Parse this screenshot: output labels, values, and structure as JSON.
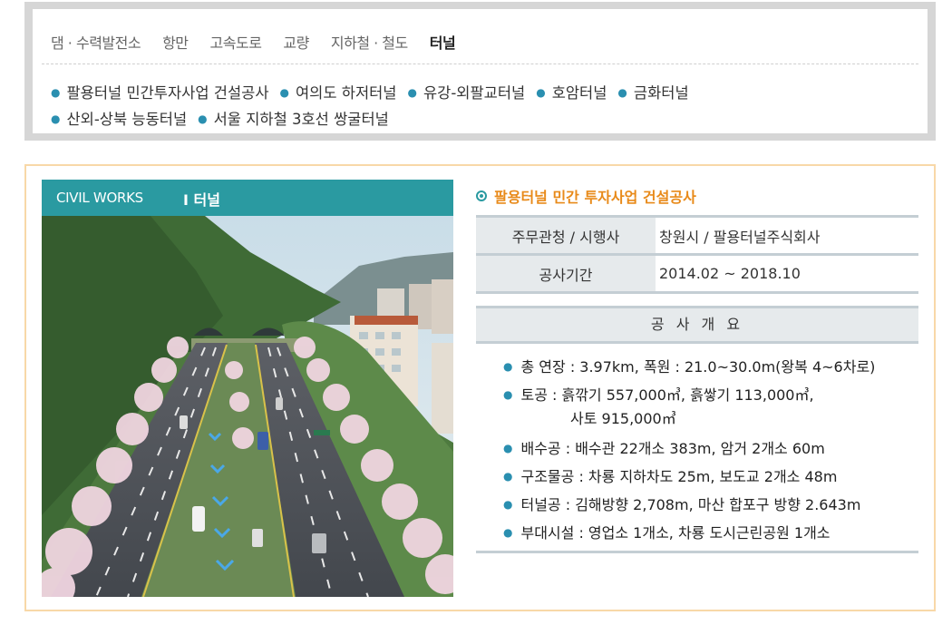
{
  "categories": [
    "댐 · 수력발전소",
    "항만",
    "고속도로",
    "교량",
    "지하철 · 철도",
    "터널"
  ],
  "active_category": "터널",
  "project_links_row1": [
    "팔용터널 민간투자사업 건설공사",
    "여의도 하저터널",
    "유강-외팔교터널",
    "호암터널",
    "금화터널"
  ],
  "project_links_row2": [
    "산외-상북 능동터널",
    "서울 지하철 3호선 쌍굴터널"
  ],
  "banner": {
    "left": "CIVIL WORKS",
    "right": "I  터널"
  },
  "project_title": "팔용터널 민간 투자사업 건설공사",
  "info_rows": [
    {
      "label": "주무관청 / 시행사",
      "value": "창원시 / 팔용터널주식회사"
    },
    {
      "label": "공사기간",
      "value": "2014.02 ~ 2018.10"
    }
  ],
  "summary_heading": "공 사 개 요",
  "summary_items": [
    "총 연장 : 3.97km, 폭원 : 21.0~30.0m(왕복 4~6차로)",
    "토공 : 흙깎기 557,000㎥, 흙쌓기 113,000㎥,",
    "사토 915,000㎥",
    "배수공 : 배수관 22개소 383m, 암거 2개소 60m",
    "구조물공 : 차룡 지하차도 25m, 보도교 2개소 48m",
    "터널공 : 김해방향 2,708m, 마산 합포구 방향 2.643m",
    "부대시설 : 영업소 1개소, 차룡 도시근린공원 1개소"
  ],
  "colors": {
    "accent": "#2a9aa1",
    "title": "#e88a1a",
    "frame": "#f8d8a8"
  }
}
